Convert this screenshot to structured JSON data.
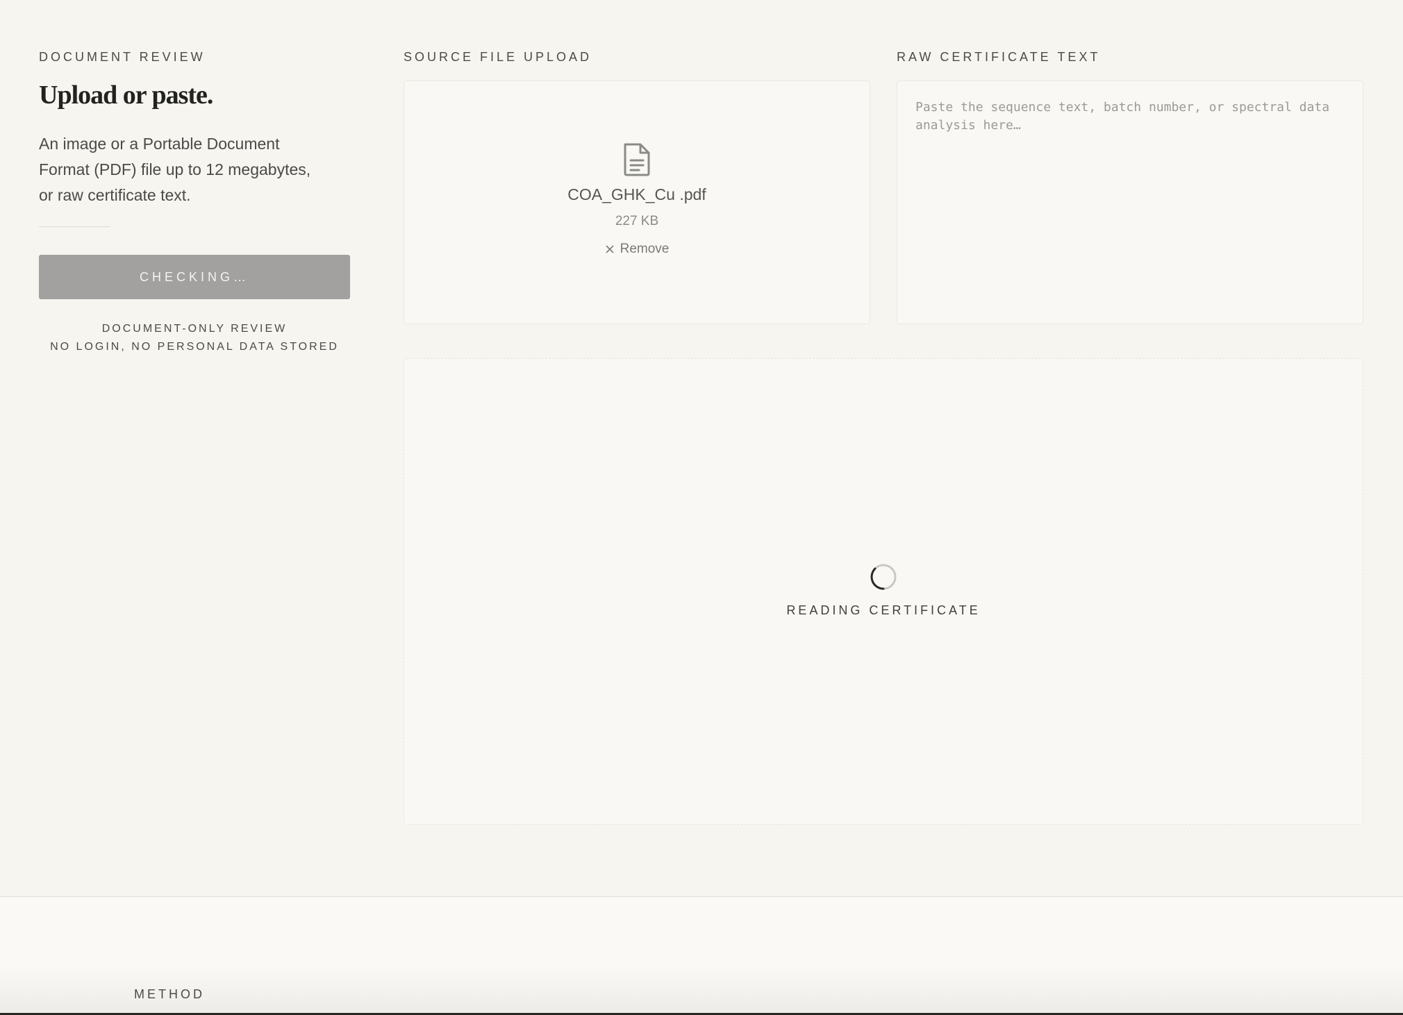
{
  "left": {
    "eyebrow": "DOCUMENT REVIEW",
    "headline": "Upload or paste.",
    "description": "An image or a Portable Document Format (PDF) file up to 12 megabytes, or raw certificate text.",
    "check_button": "CHECKING…",
    "note_line1": "DOCUMENT-ONLY REVIEW",
    "note_line2": "NO LOGIN, NO PERSONAL DATA STORED"
  },
  "upload": {
    "label": "SOURCE FILE UPLOAD",
    "file_icon": "document-icon",
    "file_name": "COA_GHK_Cu .pdf",
    "file_size": "227 KB",
    "remove_icon": "close-icon",
    "remove_label": "Remove"
  },
  "raw_text": {
    "label": "RAW CERTIFICATE TEXT",
    "value": "",
    "placeholder": "Paste the sequence text, batch number, or spectral data analysis here…"
  },
  "result": {
    "spinner_icon": "spinner-icon",
    "status": "READING CERTIFICATE"
  },
  "footer": {
    "section_label": "METHOD"
  },
  "colors": {
    "background": "#f7f5f0",
    "panel": "#f9f8f4",
    "button_disabled": "#a2a19f",
    "text": "#3a3a38"
  }
}
